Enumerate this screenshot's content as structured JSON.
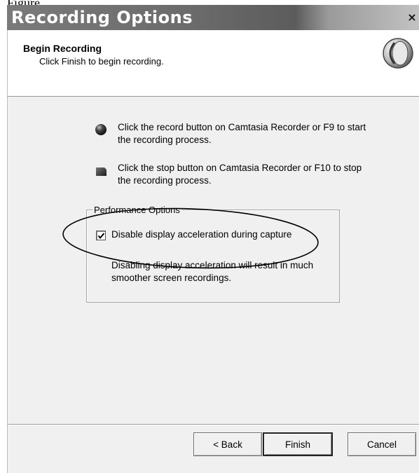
{
  "caption": {
    "top_text": "Figure"
  },
  "window": {
    "title": "Recording Options",
    "close_glyph": "×"
  },
  "header": {
    "title": "Begin Recording",
    "subtitle": "Click Finish to begin recording.",
    "logo_icon": "camtasia-logo-icon"
  },
  "instructions": [
    {
      "icon": "record-ball-icon",
      "text": "Click the record button on Camtasia Recorder or F9 to start the recording process."
    },
    {
      "icon": "stop-square-icon",
      "text": "Click the stop button on Camtasia Recorder or F10 to stop the recording process."
    }
  ],
  "performance": {
    "legend": "Performance Options",
    "checkbox_label": "Disable display acceleration during capture",
    "checked": true,
    "description": "Disabling display acceleration will result in much smoother screen recordings."
  },
  "buttons": {
    "back": "< Back",
    "finish": "Finish",
    "cancel": "Cancel"
  },
  "colors": {
    "titlebar": "#6b6b6b",
    "dialog_bg": "#f0f0f0",
    "header_bg": "#ffffff"
  }
}
